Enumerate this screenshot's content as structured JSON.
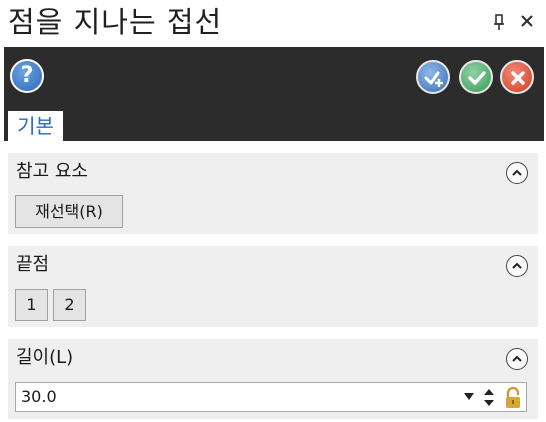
{
  "window": {
    "title": "점을 지나는 접선",
    "pin_glyph": "ᕵ",
    "close_glyph": "✕"
  },
  "toolbar": {
    "help_icon": "help-icon",
    "help_glyph": "?",
    "apply_icon": "apply-icon",
    "ok_icon": "ok-check-icon",
    "cancel_icon": "cancel-x-icon",
    "colors": {
      "toolbar_bg": "#2c2c2c",
      "help": "#2f66b8",
      "ok": "#3a9a58",
      "cancel": "#d03c22"
    }
  },
  "tabs": [
    {
      "label": "기본",
      "active": true
    }
  ],
  "sections": {
    "reference": {
      "title": "참고 요소",
      "reselect_label": "재선택(R)"
    },
    "endpoint": {
      "title": "끝점",
      "buttons": [
        "1",
        "2"
      ]
    },
    "length": {
      "title": "길이(L)",
      "value": "30.0"
    }
  }
}
